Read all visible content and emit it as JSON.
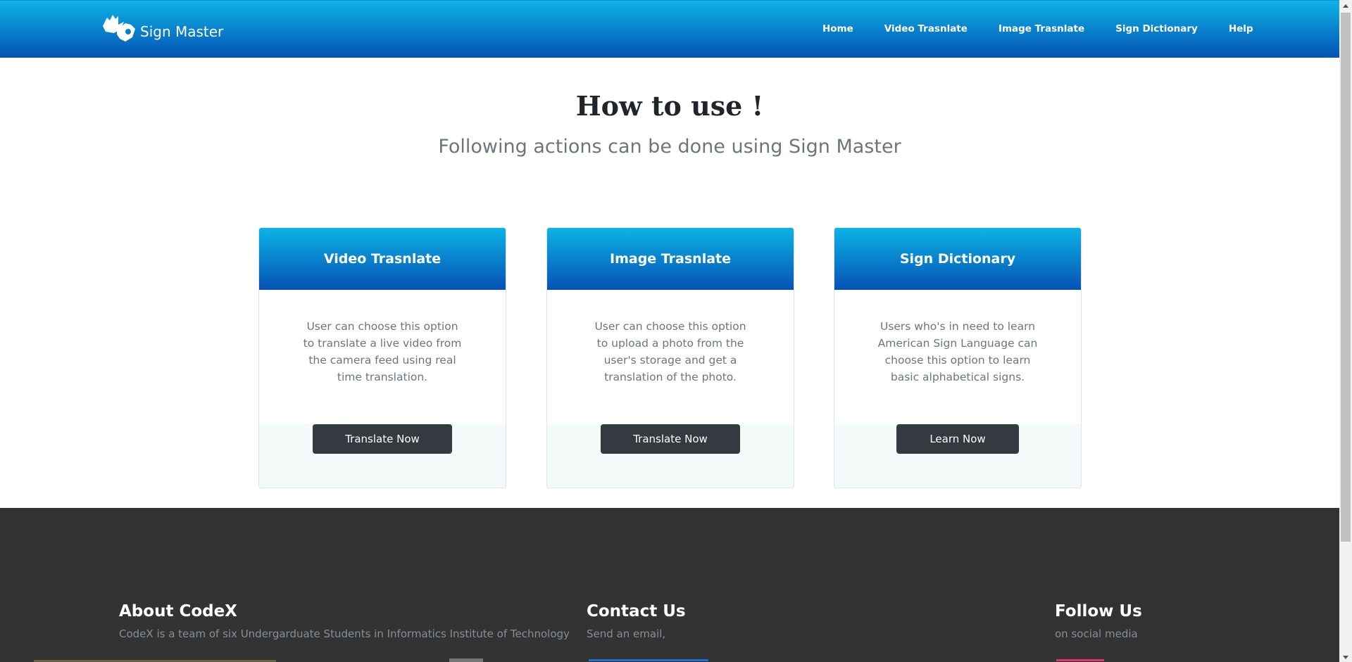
{
  "brand": {
    "name": "Sign Master"
  },
  "nav": [
    "Home",
    "Video Trasnlate",
    "Image Trasnlate",
    "Sign Dictionary",
    "Help"
  ],
  "main": {
    "title": "How to use !",
    "subtitle": "Following actions can be done using Sign Master"
  },
  "cards": [
    {
      "title": "Video Trasnlate",
      "text": "User can choose this option to translate a live video from the camera feed using real time translation.",
      "button": "Translate Now"
    },
    {
      "title": "Image Trasnlate",
      "text": "User can choose this option to upload a photo from the user's storage and get a translation of the photo.",
      "button": "Translate Now"
    },
    {
      "title": "Sign Dictionary",
      "text": "Users who's in need to learn American Sign Language can choose this option to learn basic alphabetical signs.",
      "button": "Learn Now"
    }
  ],
  "footer": {
    "about": {
      "title": "About CodeX",
      "text": "CodeX is a team of six Undergarduate Students in Informatics Institute of Technology"
    },
    "contact": {
      "title": "Contact Us",
      "text": "Send an email,"
    },
    "follow": {
      "title": "Follow Us",
      "text": "on social media"
    }
  },
  "colors": {
    "nav_gradient_top": "#0cb3e6",
    "nav_gradient_bottom": "#0652b5",
    "button": "#343a40",
    "footer": "#333333"
  }
}
